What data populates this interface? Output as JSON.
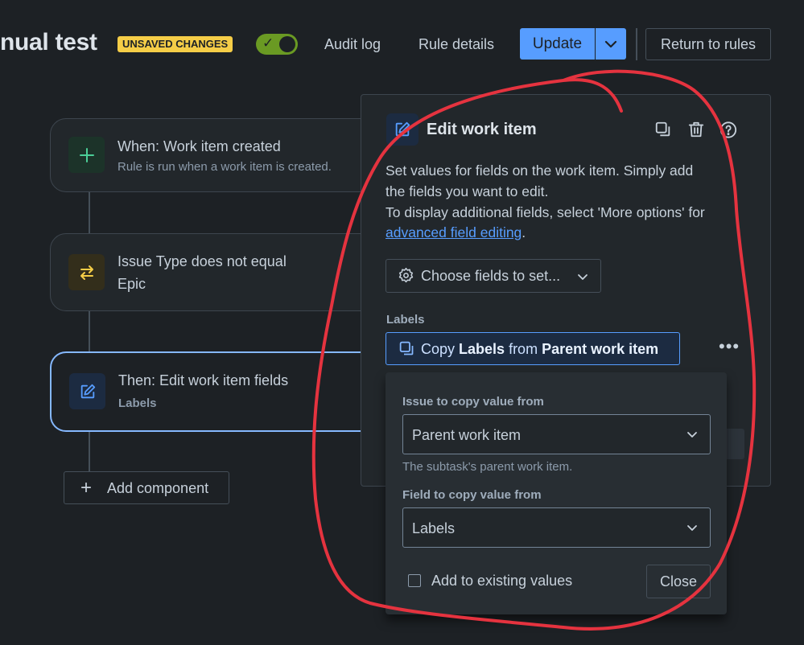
{
  "header": {
    "title": "nual test",
    "badge": "UNSAVED CHANGES",
    "audit_log": "Audit log",
    "rule_details": "Rule details",
    "update": "Update",
    "return_to_rules": "Return to rules"
  },
  "flow": {
    "trigger_title": "When: Work item created",
    "trigger_sub": "Rule is run when a work item is created.",
    "condition_title": "Issue Type does not equal",
    "condition_sub": "Epic",
    "action_title": "Then: Edit work item fields",
    "action_sub": "Labels",
    "add_component": "Add component"
  },
  "panel": {
    "title": "Edit work item",
    "desc_line1": "Set values for fields on the work item. Simply add",
    "desc_line2": "the fields you want to edit.",
    "desc_line3": "To display additional fields, select 'More options' for",
    "desc_link": "advanced field editing",
    "desc_end": ".",
    "choose_fields": "Choose fields to set...",
    "labels_label": "Labels",
    "copy_pre": "Copy ",
    "copy_field": "Labels",
    "copy_mid": " from ",
    "copy_source": "Parent work item",
    "more": "•••"
  },
  "popup": {
    "issue_label": "Issue to copy value from",
    "issue_value": "Parent work item",
    "issue_helper": "The subtask's parent work item.",
    "field_label": "Field to copy value from",
    "field_value": "Labels",
    "checkbox_label": "Add to existing values",
    "close": "Close"
  },
  "colors": {
    "background": "#1d2125",
    "accent": "#579dff",
    "badge": "#f5cd47",
    "toggle_on": "#6a9a23",
    "annotation": "#e5333f"
  },
  "icons": [
    "plus-icon",
    "swap-icon",
    "pencil-square-icon",
    "copy-icon",
    "trash-icon",
    "help-icon",
    "gear-icon",
    "chevron-down-icon"
  ]
}
